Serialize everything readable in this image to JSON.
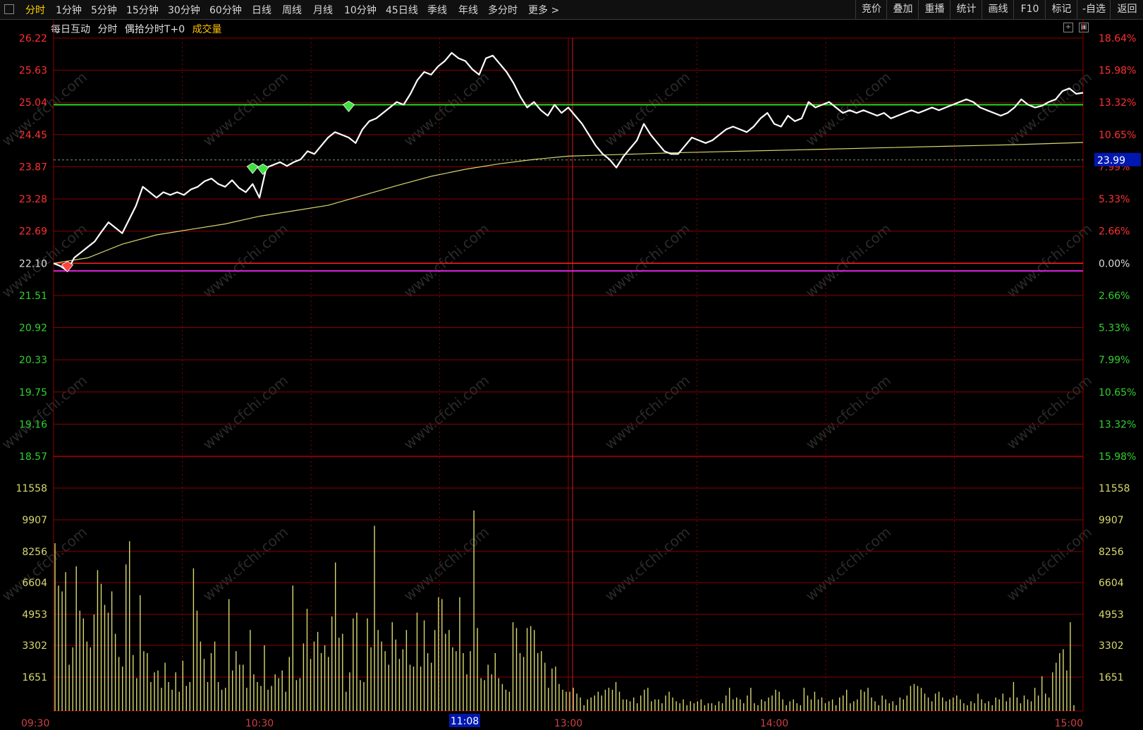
{
  "toolbar": {
    "periods": [
      "分时",
      "1分钟",
      "5分钟",
      "15分钟",
      "30分钟",
      "60分钟",
      "日线",
      "周线",
      "月线",
      "10分钟",
      "45日线",
      "季线",
      "年线",
      "多分时",
      "更多 >"
    ],
    "active_index": 0,
    "right_buttons": [
      "竞价",
      "叠加",
      "重播",
      "统计",
      "画线",
      "F10",
      "标记",
      "-自选",
      "返回"
    ]
  },
  "header": {
    "stock_name": "每日互动",
    "chart_mode": "分时",
    "indicator": "偶拾分时T+0",
    "volume_label": "成交量"
  },
  "colors": {
    "grid": "#8b0000",
    "price_line": "#ffffff",
    "avg_line": "#d8d870",
    "upper_line": "#22dd22",
    "lower_line": "#dd22dd",
    "up": "#ff3030",
    "down": "#30d030",
    "volume": "#d8d870",
    "axis_time": "#d04040",
    "current_price_bg": "#0018b0"
  },
  "chart_data": {
    "type": "line",
    "prev_close": 22.1,
    "price_ticks": [
      "26.22",
      "25.63",
      "25.04",
      "24.45",
      "23.87",
      "23.28",
      "22.69",
      "22.10",
      "21.51",
      "20.92",
      "20.33",
      "19.75",
      "19.16",
      "18.57"
    ],
    "pct_ticks": [
      "18.64%",
      "15.98%",
      "13.32%",
      "10.65%",
      "7.99%",
      "5.33%",
      "2.66%",
      "0.00%",
      "2.66%",
      "5.33%",
      "7.99%",
      "10.65%",
      "13.32%",
      "15.98%"
    ],
    "volume_ticks": [
      "11558",
      "9907",
      "8256",
      "6604",
      "4953",
      "3302",
      "1651"
    ],
    "time_labels": [
      "09:30",
      "10:30",
      "13:00",
      "14:00",
      "15:00"
    ],
    "crosshair_time": "11:08",
    "current_price": "23.99",
    "upper_level": 25.0,
    "lower_level": 21.96,
    "price_series": [
      [
        0,
        22.1
      ],
      [
        2,
        22.05
      ],
      [
        4,
        21.96
      ],
      [
        6,
        22.2
      ],
      [
        8,
        22.3
      ],
      [
        10,
        22.4
      ],
      [
        12,
        22.5
      ],
      [
        14,
        22.68
      ],
      [
        16,
        22.85
      ],
      [
        18,
        22.75
      ],
      [
        20,
        22.65
      ],
      [
        22,
        22.9
      ],
      [
        24,
        23.15
      ],
      [
        26,
        23.5
      ],
      [
        28,
        23.4
      ],
      [
        30,
        23.3
      ],
      [
        32,
        23.4
      ],
      [
        34,
        23.35
      ],
      [
        36,
        23.4
      ],
      [
        38,
        23.35
      ],
      [
        40,
        23.45
      ],
      [
        42,
        23.5
      ],
      [
        44,
        23.6
      ],
      [
        46,
        23.65
      ],
      [
        48,
        23.55
      ],
      [
        50,
        23.5
      ],
      [
        52,
        23.62
      ],
      [
        54,
        23.48
      ],
      [
        56,
        23.4
      ],
      [
        58,
        23.55
      ],
      [
        60,
        23.3
      ],
      [
        62,
        23.85
      ],
      [
        64,
        23.9
      ],
      [
        66,
        23.95
      ],
      [
        68,
        23.88
      ],
      [
        70,
        23.95
      ],
      [
        72,
        24.0
      ],
      [
        74,
        24.15
      ],
      [
        76,
        24.1
      ],
      [
        78,
        24.25
      ],
      [
        80,
        24.4
      ],
      [
        82,
        24.5
      ],
      [
        84,
        24.45
      ],
      [
        86,
        24.4
      ],
      [
        88,
        24.3
      ],
      [
        90,
        24.55
      ],
      [
        92,
        24.7
      ],
      [
        94,
        24.75
      ],
      [
        96,
        24.85
      ],
      [
        98,
        24.95
      ],
      [
        100,
        25.05
      ],
      [
        102,
        25.0
      ],
      [
        104,
        25.2
      ],
      [
        106,
        25.45
      ],
      [
        108,
        25.6
      ],
      [
        110,
        25.55
      ],
      [
        112,
        25.7
      ],
      [
        114,
        25.8
      ],
      [
        116,
        25.95
      ],
      [
        118,
        25.85
      ],
      [
        120,
        25.8
      ],
      [
        122,
        25.65
      ],
      [
        124,
        25.55
      ],
      [
        126,
        25.85
      ],
      [
        128,
        25.9
      ],
      [
        130,
        25.75
      ],
      [
        132,
        25.6
      ],
      [
        134,
        25.4
      ],
      [
        136,
        25.15
      ],
      [
        138,
        24.95
      ],
      [
        140,
        25.05
      ],
      [
        142,
        24.9
      ],
      [
        144,
        24.8
      ],
      [
        146,
        25.0
      ],
      [
        148,
        24.85
      ],
      [
        150,
        24.95
      ],
      [
        152,
        24.8
      ],
      [
        154,
        24.65
      ],
      [
        156,
        24.45
      ],
      [
        158,
        24.25
      ],
      [
        160,
        24.1
      ],
      [
        162,
        24.0
      ],
      [
        164,
        23.85
      ],
      [
        166,
        24.05
      ],
      [
        168,
        24.2
      ],
      [
        170,
        24.35
      ],
      [
        172,
        24.65
      ],
      [
        174,
        24.45
      ],
      [
        176,
        24.3
      ],
      [
        178,
        24.15
      ],
      [
        180,
        24.1
      ],
      [
        182,
        24.1
      ],
      [
        184,
        24.25
      ],
      [
        186,
        24.4
      ],
      [
        188,
        24.35
      ],
      [
        190,
        24.3
      ],
      [
        192,
        24.35
      ],
      [
        194,
        24.45
      ],
      [
        196,
        24.55
      ],
      [
        198,
        24.6
      ],
      [
        200,
        24.55
      ],
      [
        202,
        24.5
      ],
      [
        204,
        24.6
      ],
      [
        206,
        24.75
      ],
      [
        208,
        24.85
      ],
      [
        210,
        24.65
      ],
      [
        212,
        24.6
      ],
      [
        214,
        24.8
      ],
      [
        216,
        24.7
      ],
      [
        218,
        24.75
      ],
      [
        220,
        25.05
      ],
      [
        222,
        24.95
      ],
      [
        224,
        25.0
      ],
      [
        226,
        25.05
      ],
      [
        228,
        24.95
      ],
      [
        230,
        24.85
      ],
      [
        232,
        24.9
      ],
      [
        234,
        24.85
      ],
      [
        236,
        24.9
      ],
      [
        238,
        24.85
      ],
      [
        240,
        24.8
      ],
      [
        242,
        24.85
      ],
      [
        244,
        24.75
      ],
      [
        246,
        24.8
      ],
      [
        248,
        24.85
      ],
      [
        250,
        24.9
      ],
      [
        252,
        24.85
      ],
      [
        254,
        24.9
      ],
      [
        256,
        24.95
      ],
      [
        258,
        24.9
      ],
      [
        260,
        24.95
      ],
      [
        262,
        25.0
      ],
      [
        264,
        25.05
      ],
      [
        266,
        25.1
      ],
      [
        268,
        25.05
      ],
      [
        270,
        24.95
      ],
      [
        272,
        24.9
      ],
      [
        274,
        24.85
      ],
      [
        276,
        24.8
      ],
      [
        278,
        24.85
      ],
      [
        280,
        24.95
      ],
      [
        282,
        25.1
      ],
      [
        284,
        25.0
      ],
      [
        286,
        24.95
      ],
      [
        288,
        24.98
      ],
      [
        290,
        25.05
      ],
      [
        292,
        25.1
      ],
      [
        294,
        25.25
      ],
      [
        296,
        25.3
      ],
      [
        298,
        25.2
      ],
      [
        300,
        25.22
      ]
    ],
    "avg_series": [
      [
        0,
        22.1
      ],
      [
        10,
        22.2
      ],
      [
        20,
        22.45
      ],
      [
        30,
        22.62
      ],
      [
        40,
        22.72
      ],
      [
        50,
        22.82
      ],
      [
        60,
        22.96
      ],
      [
        70,
        23.06
      ],
      [
        80,
        23.16
      ],
      [
        90,
        23.34
      ],
      [
        100,
        23.52
      ],
      [
        110,
        23.69
      ],
      [
        120,
        23.82
      ],
      [
        130,
        23.92
      ],
      [
        140,
        24.0
      ],
      [
        150,
        24.06
      ],
      [
        160,
        24.08
      ],
      [
        170,
        24.1
      ],
      [
        180,
        24.12
      ],
      [
        200,
        24.15
      ],
      [
        220,
        24.18
      ],
      [
        240,
        24.21
      ],
      [
        260,
        24.24
      ],
      [
        280,
        24.27
      ],
      [
        300,
        24.31
      ]
    ],
    "volume_values": [
      8700,
      6500,
      6200,
      7200,
      2400,
      3300,
      7500,
      5200,
      4800,
      3600,
      3300,
      5000,
      7300,
      6600,
      5500,
      5100,
      6200,
      4000,
      2800,
      2300,
      7600,
      8800,
      2900,
      1700,
      6000,
      3100,
      3000,
      1500,
      2000,
      2100,
      1200,
      2500,
      1500,
      1100,
      2000,
      1000,
      2600,
      1300,
      1500,
      7400,
      5200,
      3600,
      2700,
      1500,
      3000,
      3600,
      1500,
      1100,
      1200,
      5800,
      2100,
      3100,
      2400,
      2400,
      1200,
      4200,
      1900,
      1500,
      1300,
      3400,
      1100,
      1300,
      1900,
      1700,
      2100,
      1000,
      2800,
      6500,
      1600,
      1700,
      3500,
      5300,
      2700,
      3600,
      4100,
      3000,
      3400,
      2800,
      4900,
      7700,
      3800,
      4000,
      1000,
      2000,
      4800,
      5100,
      1600,
      1500,
      4800,
      3300,
      9600,
      4200,
      3600,
      3100,
      2400,
      4600,
      3700,
      2700,
      3200,
      4200,
      2400,
      2300,
      5100,
      2300,
      4700,
      3000,
      2500,
      4200,
      5900,
      5800,
      4000,
      4200,
      3300,
      3100,
      5900,
      3000,
      1900,
      3100,
      10400,
      4300,
      1700,
      1600,
      2400,
      1900,
      3000,
      1700,
      1400,
      1100,
      1000,
      4600,
      4300,
      3000,
      2800,
      4300,
      4400,
      4200,
      3000,
      3100,
      2500,
      1200,
      2200,
      2300,
      1400,
      1100,
      1000,
      1000,
      1200,
      900,
      700,
      300,
      600,
      700,
      800,
      1000,
      800,
      1100,
      1200,
      1100,
      1500,
      1000,
      600,
      600,
      500,
      700,
      400,
      800,
      1100,
      1200,
      500,
      600,
      600,
      400,
      800,
      1000,
      700,
      500,
      400,
      600,
      300,
      500,
      400,
      500,
      600,
      300,
      400,
      400,
      300,
      500,
      400,
      800,
      1200,
      600,
      700,
      600,
      400,
      800,
      1200,
      400,
      300,
      600,
      500,
      700,
      800,
      1100,
      1000,
      600,
      300,
      500,
      600,
      400,
      300,
      1200,
      800,
      600,
      1000,
      600,
      700,
      400,
      500,
      600,
      300,
      700,
      800,
      1100,
      400,
      500,
      600,
      1100,
      1000,
      1200,
      700,
      500,
      300,
      800,
      600,
      400,
      500,
      300,
      700,
      600,
      800,
      1300,
      1400,
      1300,
      1200,
      900,
      700,
      500,
      900,
      1000,
      700,
      500,
      600,
      700,
      800,
      600,
      400,
      300,
      500,
      400,
      900,
      600,
      400,
      500,
      300,
      700,
      600,
      900,
      500,
      700,
      1500,
      700,
      400,
      800,
      600,
      500,
      1200,
      800,
      1800,
      900,
      700,
      2000,
      2500,
      3000,
      3200,
      2100,
      4600,
      300
    ]
  },
  "watermark": "www.cfchi.com"
}
